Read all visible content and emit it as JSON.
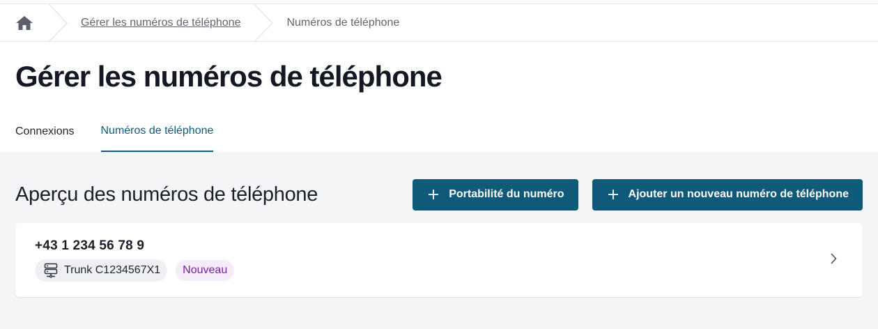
{
  "breadcrumb": {
    "home_icon": "home-icon",
    "items": [
      {
        "label": "Gérer les numéros de téléphone",
        "link": true
      },
      {
        "label": "Numéros de téléphone",
        "link": false
      }
    ]
  },
  "page_title": "Gérer les numéros de téléphone",
  "tabs": [
    {
      "label": "Connexions",
      "active": false
    },
    {
      "label": "Numéros de téléphone",
      "active": true
    }
  ],
  "overview": {
    "title": "Aperçu des numéros de téléphone",
    "buttons": {
      "port_number": "Portabilité du numéro",
      "add_number": "Ajouter un nouveau numéro de téléphone"
    }
  },
  "numbers": [
    {
      "phone": "+43 1 234 56 78 9",
      "trunk": "Trunk C1234567X1",
      "trunk_icon": "server-icon",
      "badge": "Nouveau"
    }
  ],
  "colors": {
    "primary": "#0f5a79",
    "badge_text": "#7a1fa6",
    "badge_bg": "#f5ecfa",
    "content_bg": "#f4f5f7"
  }
}
